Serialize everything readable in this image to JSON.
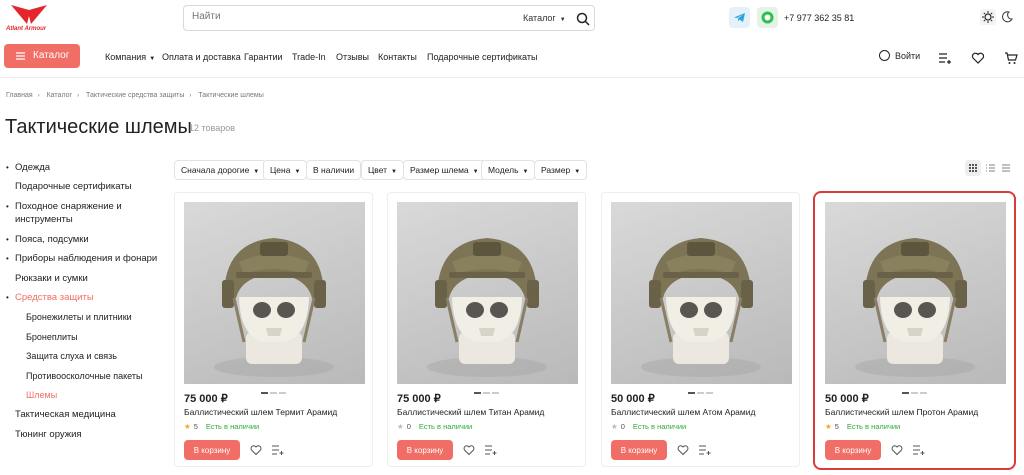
{
  "header": {
    "logo_text": "Atlant Armour",
    "search_placeholder": "Найти",
    "search_category": "Каталог",
    "phone": "+7 977 362 35 81"
  },
  "nav": {
    "catalog_label": "Каталог",
    "items": [
      "Компания",
      "Оплата и доставка",
      "Гарантии",
      "Trade-In",
      "Отзывы",
      "Контакты",
      "Подарочные сертификаты"
    ],
    "login": "Войти"
  },
  "breadcrumbs": [
    "Главная",
    "Каталог",
    "Тактические средства защиты",
    "Тактические шлемы"
  ],
  "page": {
    "title": "Тактические шлемы",
    "count": "12 товаров"
  },
  "sidebar": {
    "items": [
      {
        "label": "Одежда"
      },
      {
        "label": "Подарочные сертификаты"
      },
      {
        "label": "Походное снаряжение и"
      },
      {
        "label": "инструменты"
      },
      {
        "label": "Пояса, подсумки"
      },
      {
        "label": "Приборы наблюдения и фонари"
      },
      {
        "label": "Рюкзаки и сумки"
      },
      {
        "label": "Средства защиты"
      },
      {
        "label": "Бронежилеты и плитники"
      },
      {
        "label": "Бронеплиты"
      },
      {
        "label": "Защита слуха и связь"
      },
      {
        "label": "Противоосколочные пакеты"
      },
      {
        "label": "Шлемы"
      },
      {
        "label": "Тактическая медицина"
      },
      {
        "label": "Тюнинг оружия"
      }
    ]
  },
  "filters": [
    "Сначала дорогие",
    "Цена",
    "В наличии",
    "Цвет",
    "Размер шлема",
    "Модель",
    "Размер"
  ],
  "products": [
    {
      "price": "75 000 ₽",
      "name": "Баллистический шлем Термит Арамид",
      "rating": "5",
      "stock": "Есть в наличии",
      "button": "В корзину"
    },
    {
      "price": "75 000 ₽",
      "name": "Баллистический шлем Титан Арамид",
      "rating": "0",
      "stock": "Есть в наличии",
      "button": "В корзину"
    },
    {
      "price": "50 000 ₽",
      "name": "Баллистический шлем Атом Арамид",
      "rating": "0",
      "stock": "Есть в наличии",
      "button": "В корзину"
    },
    {
      "price": "50 000 ₽",
      "name": "Баллистический шлем Протон Арамид",
      "rating": "5",
      "stock": "Есть в наличии",
      "button": "В корзину"
    }
  ],
  "colors": {
    "accent": "#f06e66",
    "highlight": "#d93a3a",
    "stock": "#2eaa3a",
    "star": "#f5a623"
  }
}
